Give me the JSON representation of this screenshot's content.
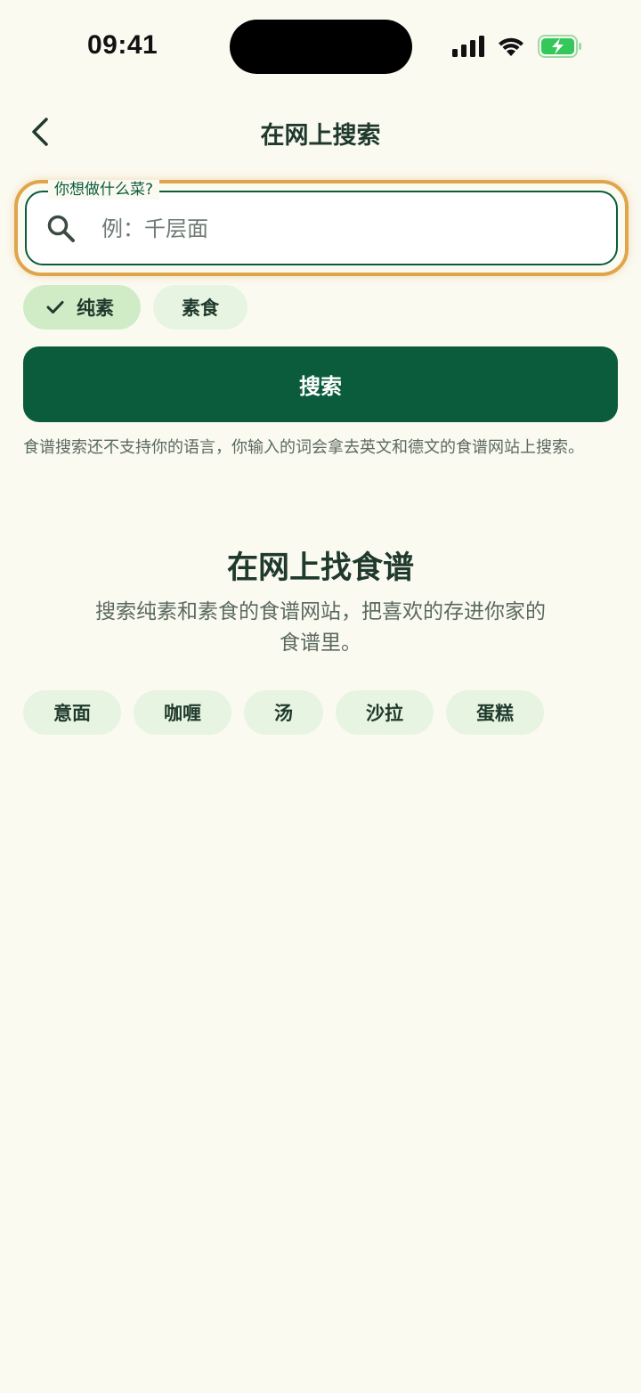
{
  "status_bar": {
    "time": "09:41"
  },
  "app_bar": {
    "title": "在网上搜索"
  },
  "search": {
    "label": "你想做什么菜?",
    "placeholder": "例：千层面",
    "value": ""
  },
  "diet_filters": [
    {
      "label": "纯素",
      "selected": true
    },
    {
      "label": "素食",
      "selected": false
    }
  ],
  "search_button_label": "搜索",
  "notice": "食谱搜索还不支持你的语言，你输入的词会拿去英文和德文的食谱网站上搜索。",
  "empty_state": {
    "title": "在网上找食谱",
    "description": "搜索纯素和素食的食谱网站，把喜欢的存进你家的食谱里。"
  },
  "suggestions": [
    {
      "label": "意面"
    },
    {
      "label": "咖喱"
    },
    {
      "label": "汤"
    },
    {
      "label": "沙拉"
    },
    {
      "label": "蛋糕"
    }
  ],
  "colors": {
    "background": "#FBFAF1",
    "primary": "#0A5C3C",
    "focus_ring": "#E0A54A",
    "chip_bg": "#E8F4E2",
    "chip_selected_bg": "#CFECC7",
    "battery": "#34C759"
  },
  "icons": {
    "back": "chevron-left-icon",
    "search": "magnifier-icon",
    "check": "checkmark-icon"
  }
}
